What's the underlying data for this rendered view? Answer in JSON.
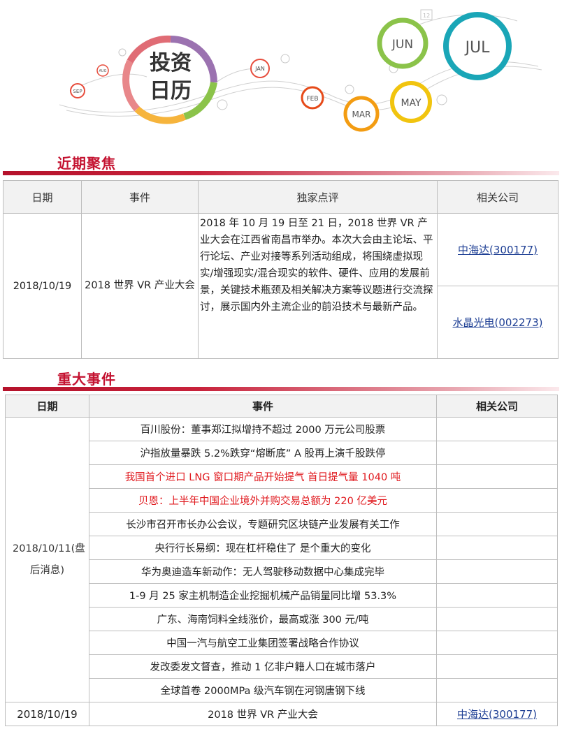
{
  "banner": {
    "logo_line1": "投资",
    "logo_line2": "日历",
    "months": {
      "sep": "SEP",
      "aug": "AUG",
      "jan": "JAN",
      "feb": "FEB",
      "mar": "MAR",
      "may": "MAY",
      "jun": "JUN",
      "jul": "JUL",
      "calendar_day": "12"
    }
  },
  "focus": {
    "title": "近期聚焦",
    "headers": {
      "date": "日期",
      "event": "事件",
      "comment": "独家点评",
      "companies": "相关公司"
    },
    "row": {
      "date": "2018/10/19",
      "event": "2018 世界 VR 产业大会",
      "comment": "2018 年 10 月 19 日至 21 日，2018 世界 VR 产业大会在江西省南昌市举办。本次大会由主论坛、平行论坛、产业对接等系列活动组成，将围绕虚拟现实/增强现实/混合现实的软件、硬件、应用的发展前景，关键技术瓶颈及相关解决方案等议题进行交流探讨，展示国内外主流企业的前沿技术与最新产品。",
      "company1": "中海达(300177)",
      "company2": "水晶光电(002273)"
    }
  },
  "events": {
    "title": "重大事件",
    "headers": {
      "date": "日期",
      "event": "事件",
      "companies": "相关公司"
    },
    "group_date": "2018/10/11(盘后消息)",
    "items": [
      "百川股份：董事郑江拟增持不超过 2000 万元公司股票",
      "沪指放量暴跌 5.2%跌穿“熔断底” A 股再上演千股跌停",
      "我国首个进口 LNG 窗口期产品开始提气 首日提气量 1040 吨",
      "贝恩：上半年中国企业境外并购交易总额为 220 亿美元",
      "长沙市召开市长办公会议，专题研究区块链产业发展有关工作",
      "央行行长易纲：现在杠杆稳住了 是个重大的变化",
      "华为奥迪造车新动作：无人驾驶移动数据中心集成完毕",
      "1-9 月 25 家主机制造企业挖掘机械产品销量同比增 53.3%",
      "广东、海南饲料全线涨价，最高或涨 300 元/吨",
      "中国一汽与航空工业集团签署战略合作协议",
      "发改委发文督查，推动 1 亿非户籍人口在城市落户",
      "全球首卷 2000MPa 级汽车钢在河钢唐钢下线"
    ],
    "last_row": {
      "date": "2018/10/19",
      "event": "2018 世界 VR 产业大会",
      "company": "中海达(300177)"
    }
  },
  "colors": {
    "accent_red": "#c41230",
    "link_blue": "#1e3f94",
    "highlight_red": "#e0191e",
    "header_gray": "#f2f2f2"
  }
}
